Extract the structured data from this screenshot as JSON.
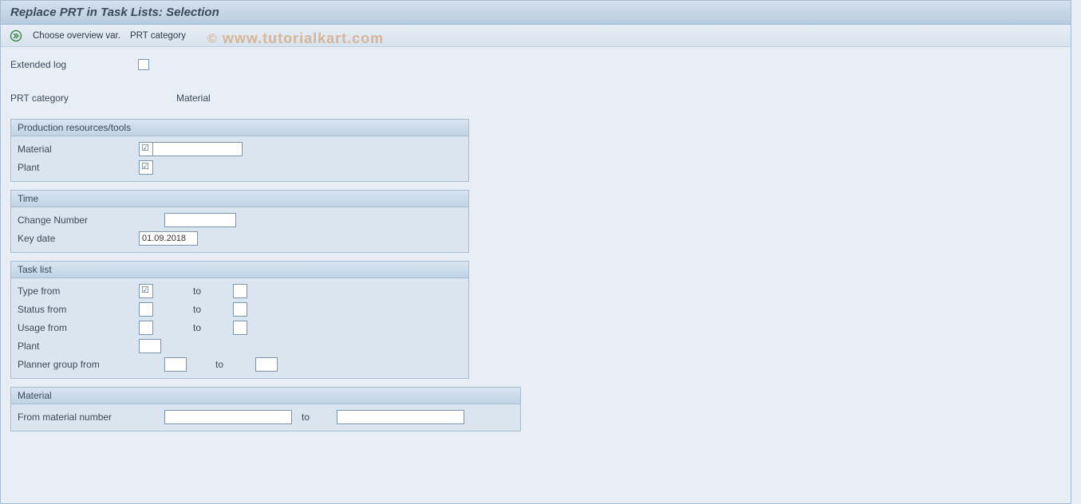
{
  "title": "Replace PRT in Task Lists: Selection",
  "toolbar": {
    "choose_overview": "Choose overview var.",
    "prt_category": "PRT category"
  },
  "top": {
    "extended_log_label": "Extended log",
    "extended_log_checked": false,
    "prt_category_label": "PRT category",
    "prt_category_value": "Material"
  },
  "groups": {
    "prt": {
      "title": "Production resources/tools",
      "material_label": "Material",
      "plant_label": "Plant"
    },
    "time": {
      "title": "Time",
      "change_number_label": "Change Number",
      "change_number_value": "",
      "key_date_label": "Key date",
      "key_date_value": "01.09.2018"
    },
    "tasklist": {
      "title": "Task list",
      "type_from_label": "Type from",
      "status_from_label": "Status from",
      "usage_from_label": "Usage from",
      "plant_label": "Plant",
      "planner_group_label": "Planner group from",
      "to_label": "to"
    },
    "material": {
      "title": "Material",
      "from_material_label": "From material number",
      "to_label": "to"
    }
  },
  "watermark": "www.tutorialkart.com"
}
